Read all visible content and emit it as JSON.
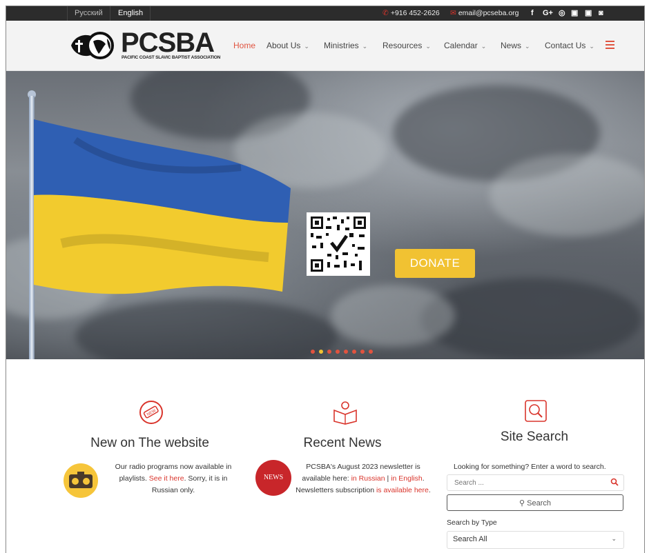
{
  "topbar": {
    "languages": [
      "Русский",
      "English"
    ],
    "phone": "+916 452-2626",
    "email": "email@pcseba.org",
    "social": [
      "f",
      "G+",
      "◎",
      "▣",
      "▣",
      "◙"
    ]
  },
  "logo": {
    "name": "PCSBA",
    "tagline": "PACIFIC COAST SLAVIC BAPTIST ASSOCIATION"
  },
  "nav": {
    "items": [
      {
        "label": "Home"
      },
      {
        "label": "About Us"
      },
      {
        "label": "Ministries"
      },
      {
        "label": "Resources"
      },
      {
        "label": "Calendar"
      },
      {
        "label": "News"
      },
      {
        "label": "Contact Us"
      }
    ]
  },
  "hero": {
    "donate_label": "DONATE",
    "slide_count": 8,
    "active_slide": 2
  },
  "columns": {
    "new": {
      "title": "New on The website",
      "text1": "Our radio programs now available in playlists. ",
      "link": "See it here",
      "text2": ". Sorry, it is in Russian only."
    },
    "news": {
      "title": "Recent News",
      "badge": "NEWS",
      "text1": "PCSBA's August 2023 newsletter is available here: ",
      "link_ru": "in Russian",
      "sep": " | ",
      "link_en": "in English",
      "text2": ". Newsletters subscription ",
      "link_sub": "is available here",
      "text3": "."
    },
    "search": {
      "title": "Site Search",
      "prompt": "Looking for something? Enter a word to search.",
      "placeholder": "Search ...",
      "button_label": "Search",
      "type_label": "Search by Type",
      "type_value": "Search All"
    }
  },
  "colors": {
    "accent": "#e0533f",
    "donate": "#f1c232",
    "topbar": "#2c2c2c",
    "news_badge": "#c8262a"
  }
}
